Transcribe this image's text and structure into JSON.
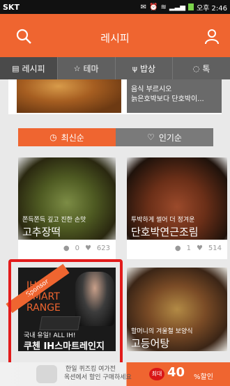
{
  "status_bar": {
    "carrier": "SKT",
    "time": "오후 2:46"
  },
  "header": {
    "title": "레시피"
  },
  "tabs": [
    {
      "label": "레시피"
    },
    {
      "label": "테마"
    },
    {
      "label": "밥상"
    },
    {
      "label": "톡"
    }
  ],
  "top_card": {
    "description_line1": "음식 부르시오",
    "description_line2": "늙은호박보다 단호박이..."
  },
  "sort": {
    "latest": "최신순",
    "popular": "인기순"
  },
  "cards": [
    {
      "subtitle": "쫀득쫀득 깊고 진한 손맛",
      "title": "고추장떡",
      "comments": "0",
      "likes": "623"
    },
    {
      "subtitle": "투박하게 썰어 더 정겨운",
      "title": "단호박연근조림",
      "comments": "1",
      "likes": "514"
    },
    {
      "sponsor": "Sponsor",
      "brand_line1": "IH",
      "brand_line2": "SMART",
      "brand_line3": "RANGE",
      "subtitle": "국내 유일! ALL IH!",
      "title": "쿠첸 IH스마트레인지"
    },
    {
      "subtitle": "할머니의 겨울철 보양식",
      "title": "고등어탕"
    }
  ],
  "banner": {
    "line1": "한일 퀴즈킹 여가전",
    "line2": "옥션에서 할인 구매하세요",
    "badge": "최대",
    "percent": "40",
    "suffix": "%할인"
  },
  "colors": {
    "accent": "#ef6530",
    "tabbar": "#606060",
    "ad_outline": "#e21b1b"
  }
}
